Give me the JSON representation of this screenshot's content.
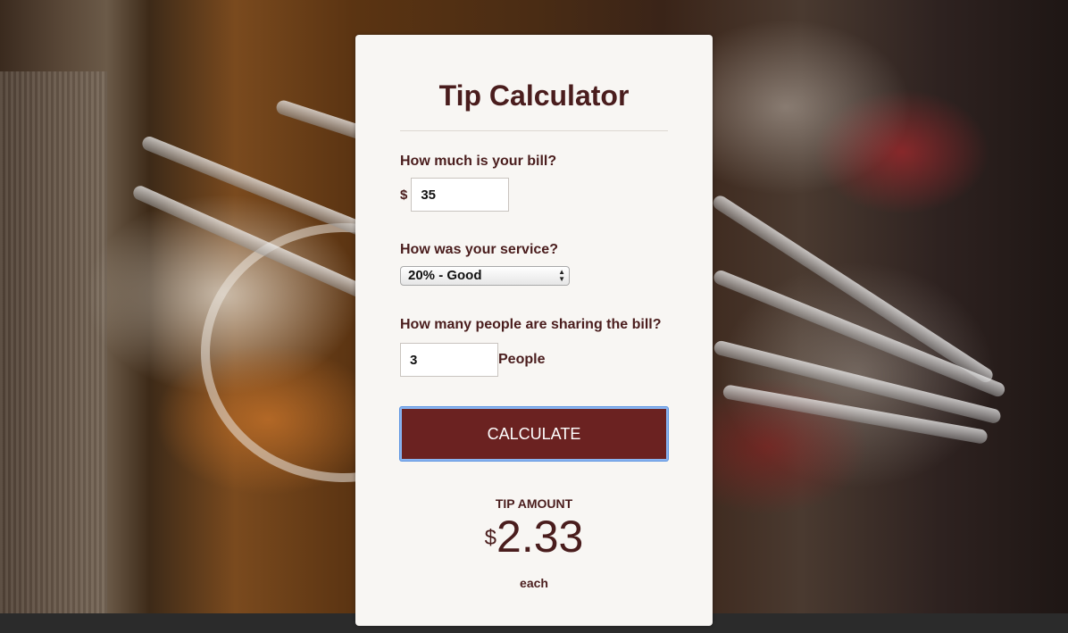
{
  "calculator": {
    "title": "Tip Calculator",
    "bill": {
      "question": "How much is your bill?",
      "currency_symbol": "$",
      "value": "35"
    },
    "service": {
      "question": "How was your service?",
      "selected_option": "20% - Good"
    },
    "people": {
      "question": "How many people are sharing the bill?",
      "value": "3",
      "suffix": "People"
    },
    "calculate_button_label": "CALCULATE",
    "result": {
      "label": "TIP AMOUNT",
      "currency_symbol": "$",
      "amount": "2.33",
      "unit": "each"
    }
  },
  "colors": {
    "accent": "#6b2221",
    "text": "#4a1d1d",
    "card_background": "#f8f6f3",
    "focus_ring": "#5c94e2"
  },
  "icons": {
    "select_arrows": "updown-arrows-icon"
  }
}
